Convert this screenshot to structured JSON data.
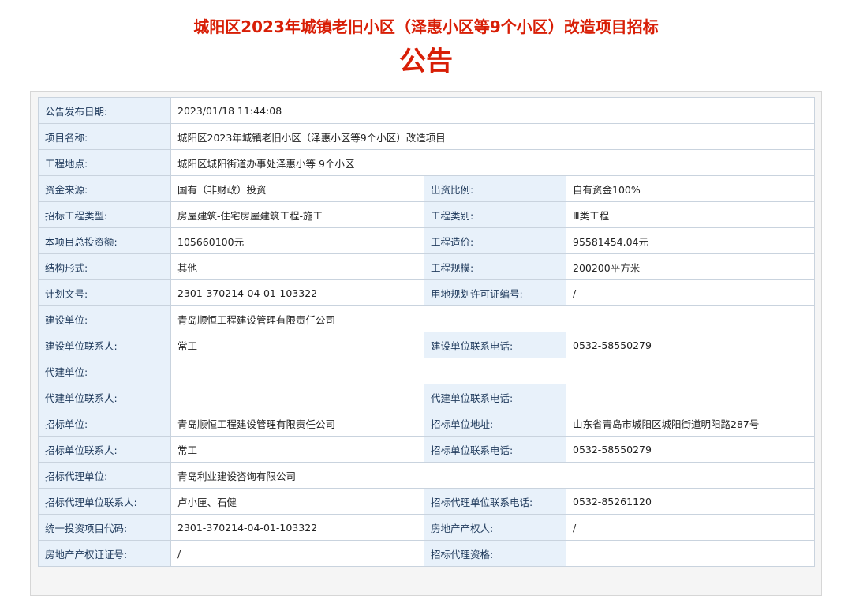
{
  "title": {
    "line1": "城阳区2023年城镇老旧小区（泽惠小区等9个小区）改造项目招标",
    "line2": "公告"
  },
  "rows": [
    {
      "label": "公告发布日期:",
      "value": "2023/01/18 11:44:08"
    },
    {
      "label": "项目名称:",
      "value": "城阳区2023年城镇老旧小区（泽惠小区等9个小区）改造项目"
    },
    {
      "label": "工程地点:",
      "value": "城阳区城阳街道办事处泽惠小等 9个小区"
    },
    {
      "label": "资金来源:",
      "value": "国有（非财政）投资",
      "label2": "出资比例:",
      "value2": "自有资金100%"
    },
    {
      "label": "招标工程类型:",
      "value": "房屋建筑-住宅房屋建筑工程-施工",
      "label2": "工程类别:",
      "value2": "Ⅲ类工程"
    },
    {
      "label": "本项目总投资额:",
      "value": "105660100元",
      "label2": "工程造价:",
      "value2": "95581454.04元"
    },
    {
      "label": "结构形式:",
      "value": "其他",
      "label2": "工程规模:",
      "value2": "200200平方米"
    },
    {
      "label": "计划文号:",
      "value": "2301-370214-04-01-103322",
      "label2": "用地规划许可证编号:",
      "value2": "/"
    },
    {
      "label": "建设单位:",
      "value": "青岛顺恒工程建设管理有限责任公司"
    },
    {
      "label": "建设单位联系人:",
      "value": "常工",
      "label2": "建设单位联系电话:",
      "value2": "0532-58550279"
    },
    {
      "label": "代建单位:",
      "value": ""
    },
    {
      "label": "代建单位联系人:",
      "value": "",
      "label2": "代建单位联系电话:",
      "value2": ""
    },
    {
      "label": "招标单位:",
      "value": "青岛顺恒工程建设管理有限责任公司",
      "label2": "招标单位地址:",
      "value2": "山东省青岛市城阳区城阳街道明阳路287号"
    },
    {
      "label": "招标单位联系人:",
      "value": "常工",
      "label2": "招标单位联系电话:",
      "value2": "0532-58550279"
    },
    {
      "label": "招标代理单位:",
      "value": "青岛利业建设咨询有限公司"
    },
    {
      "label": "招标代理单位联系人:",
      "value": "卢小匣、石健",
      "label2": "招标代理单位联系电话:",
      "value2": "0532-85261120"
    },
    {
      "label": "统一投资项目代码:",
      "value": "2301-370214-04-01-103322",
      "label2": "房地产产权人:",
      "value2": "/"
    },
    {
      "label": "房地产产权证证号:",
      "value": "/",
      "label2": "招标代理资格:",
      "value2": ""
    }
  ]
}
